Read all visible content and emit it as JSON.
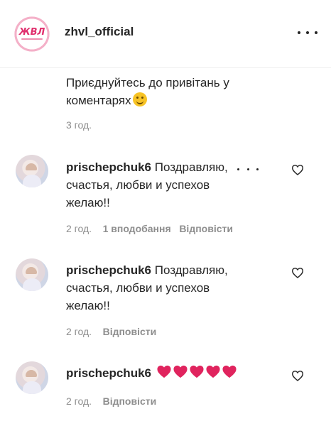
{
  "header": {
    "avatar_logo_text": "ЖВЛ",
    "username": "zhvl_official",
    "more_icon": "more-horizontal-icon"
  },
  "caption": {
    "text": "Приєднуйтесь до привітань у коментарях",
    "emoji": "winking-face-emoji",
    "time": "3 год."
  },
  "comments": [
    {
      "author": "prischepchuk6",
      "text": "Поздравляю, счастья, любви и успехов желаю!!",
      "time": "2 год.",
      "likes": "1 вподобання",
      "reply": "Відповісти",
      "has_options": true
    },
    {
      "author": "prischepchuk6",
      "text": "Поздравляю, счастья, любви и успехов желаю!!",
      "time": "2 год.",
      "reply": "Відповісти"
    },
    {
      "author": "prischepchuk6",
      "hearts": 5,
      "time": "2 год.",
      "reply": "Відповісти"
    }
  ],
  "colors": {
    "text": "#262626",
    "meta": "#8e8e8e",
    "heart_red": "#e0245e",
    "brand_pink": "#e0306e"
  }
}
